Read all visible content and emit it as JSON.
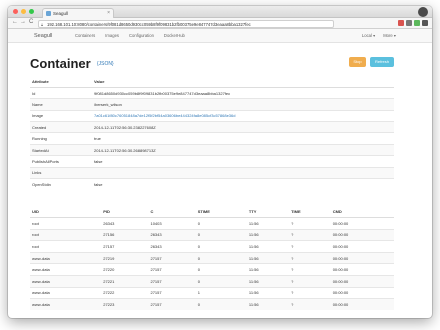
{
  "browser": {
    "tab_title": "Seagull",
    "tab_close": "×",
    "url": "192.168.101.10:8080/containers/9f081d8650d930cc059b8f9f09831b2fb00375e9e847747d3eaaa8bba1327fec",
    "back": "←",
    "forward": "→",
    "reload": "C"
  },
  "navbar": {
    "brand": "Seagull",
    "links": [
      "Containers",
      "Images",
      "Configuration",
      "DockerHub"
    ],
    "right": [
      "Local ▾",
      "More ▾"
    ]
  },
  "page": {
    "title": "Container",
    "json_label": "{JSON}",
    "stop_label": "Stop",
    "refresh_label": "Refresh"
  },
  "attributes": {
    "headers": [
      "Attribute",
      "Value"
    ],
    "rows": [
      {
        "key": "Id",
        "value": "9f081d8650d930cc059b8f9f09831b2fb00375e9e847747d3eaaa8bba1327fec"
      },
      {
        "key": "Name",
        "value": "/berserk_wilson"
      },
      {
        "key": "Image",
        "value": "7a01c61f80c76051848a7de12f5f2bf54a03606be444324fa8e085cf3c57868e36d"
      },
      {
        "key": "Created",
        "value": "2014-12-11T02:56:30.238227608Z"
      },
      {
        "key": "Running",
        "value": "true"
      },
      {
        "key": "StartedAt",
        "value": "2014-12-11T02:56:30.268898713Z"
      },
      {
        "key": "PublishAllPorts",
        "value": "false"
      },
      {
        "key": "Links",
        "value": ""
      },
      {
        "key": "OpenStdin",
        "value": "false"
      }
    ]
  },
  "processes": {
    "headers": [
      "UID",
      "PID",
      "C",
      "STIME",
      "TTY",
      "TIME",
      "CMD"
    ],
    "rows": [
      [
        "root",
        "26343",
        "10403",
        "0",
        "11:56",
        "?",
        "00:00:00"
      ],
      [
        "root",
        "27156",
        "26343",
        "0",
        "11:56",
        "?",
        "00:00:00"
      ],
      [
        "root",
        "27157",
        "26343",
        "0",
        "11:56",
        "?",
        "00:00:00"
      ],
      [
        "www-data",
        "27219",
        "27157",
        "0",
        "11:56",
        "?",
        "00:00:00"
      ],
      [
        "www-data",
        "27220",
        "27157",
        "0",
        "11:56",
        "?",
        "00:00:00"
      ],
      [
        "www-data",
        "27221",
        "27157",
        "0",
        "11:56",
        "?",
        "00:00:00"
      ],
      [
        "www-data",
        "27222",
        "27157",
        "1",
        "11:56",
        "?",
        "00:00:00"
      ],
      [
        "www-data",
        "27223",
        "27157",
        "0",
        "11:56",
        "?",
        "00:00:00"
      ]
    ]
  },
  "colors": {
    "stop": "#f0ad4e",
    "refresh": "#5bc0de",
    "link": "#337ab7"
  },
  "icons": {
    "window_controls": [
      "close-light-icon",
      "minimize-light-icon",
      "zoom-light-icon"
    ],
    "extensions": [
      "shield-icon",
      "bookmark-icon",
      "extension-icon",
      "menu-icon"
    ]
  }
}
